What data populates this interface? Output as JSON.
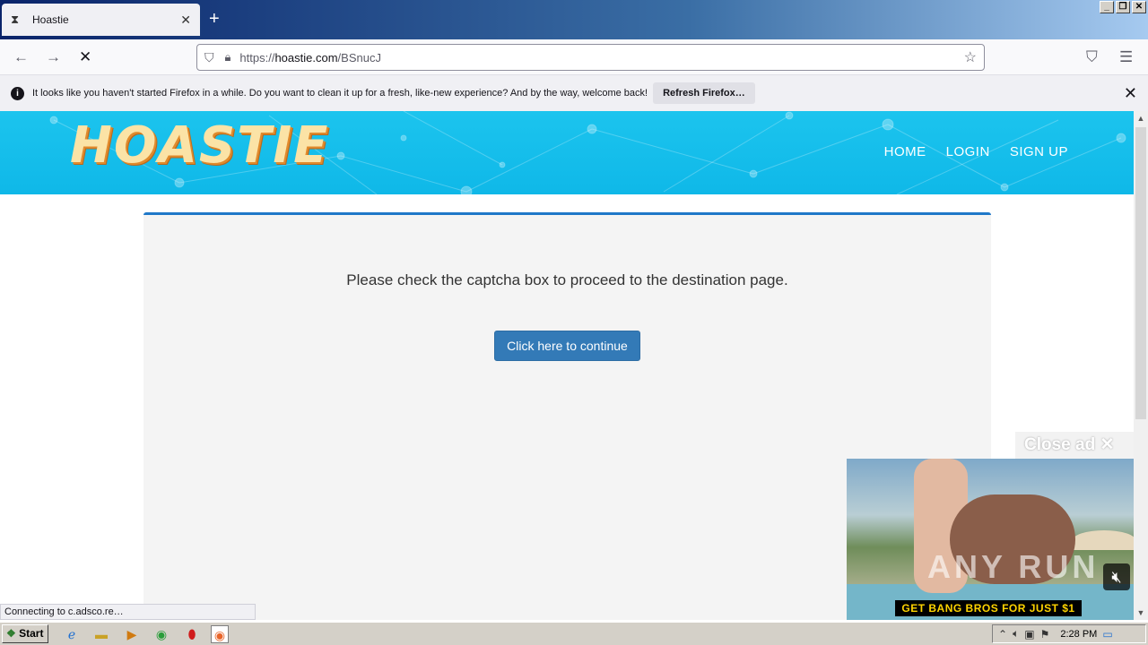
{
  "browser": {
    "tab_title": "Hoastie",
    "url_prefix": "https://",
    "url_domain": "hoastie.com",
    "url_path": "/BSnucJ",
    "notification": "It looks like you haven't started Firefox in a while. Do you want to clean it up for a fresh, like-new experience? And by the way, welcome back!",
    "refresh_label": "Refresh Firefox…",
    "status_text": "Connecting to c.adsco.re…"
  },
  "site": {
    "logo": "HOASTIE",
    "menu": [
      "HOME",
      "LOGIN",
      "SIGN UP"
    ],
    "message": "Please check the captcha box to proceed to the destination page.",
    "continue_label": "Click here to continue"
  },
  "ad": {
    "close_label": "Close ad",
    "banner_text": "GET BANG BROS FOR JUST $1",
    "watermark": "ANY RUN"
  },
  "taskbar": {
    "start_label": "Start",
    "clock": "2:28 PM"
  },
  "colors": {
    "header": "#1cc4ee",
    "accent_button": "#337ab7",
    "card_border": "#1f78c8"
  }
}
